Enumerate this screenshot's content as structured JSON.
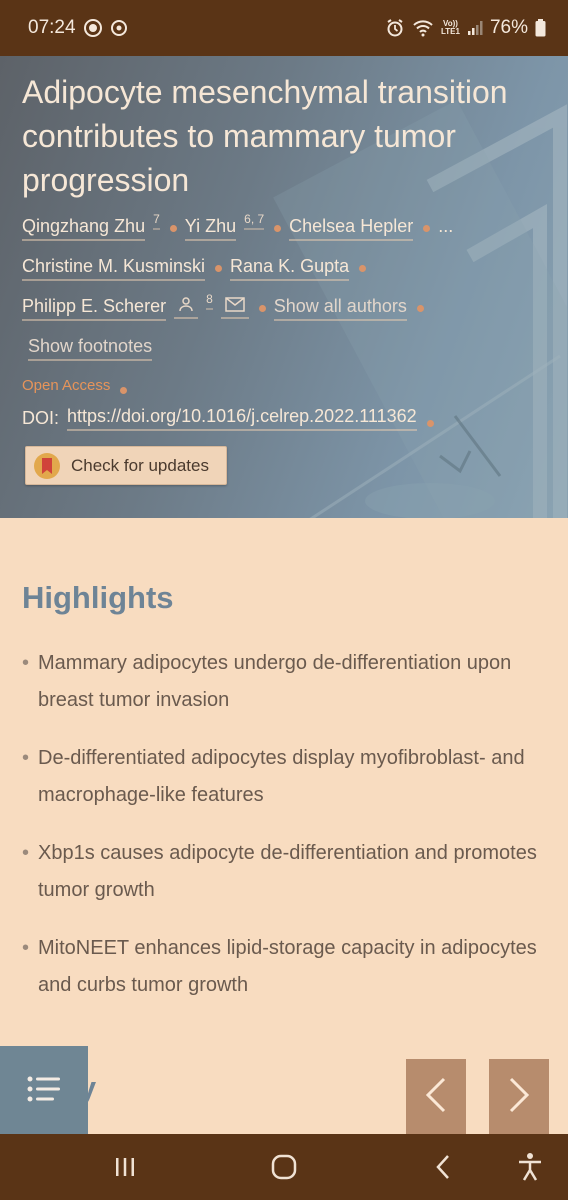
{
  "status_bar": {
    "time": "07:24",
    "network_top": "Vo))",
    "network_bottom": "LTE1",
    "battery": "76%",
    "icons": [
      "media-icon",
      "cast-icon",
      "alarm-icon",
      "wifi-icon",
      "signal-icon",
      "battery-icon"
    ]
  },
  "article": {
    "title": "Adipocyte mesenchymal transition contributes to mammary tumor progression",
    "authors": [
      {
        "name": "Qingzhang Zhu",
        "sup": "7"
      },
      {
        "name": "Yi Zhu",
        "sup": "6, 7"
      },
      {
        "name": "Chelsea Hepler",
        "sup": ""
      },
      {
        "name": "Christine M. Kusminski",
        "sup": ""
      },
      {
        "name": "Rana K. Gupta",
        "sup": ""
      },
      {
        "name": "Philipp E. Scherer",
        "sup": "8"
      }
    ],
    "ellipsis": "...",
    "show_all_authors": "Show all authors",
    "show_footnotes": "Show footnotes",
    "open_access": "Open Access",
    "doi_label": "DOI:",
    "doi_link": "https://doi.org/10.1016/j.celrep.2022.111362",
    "check_updates": "Check for updates"
  },
  "highlights": {
    "heading": "Highlights",
    "items": [
      "Mammary adipocytes undergo de-differentiation upon breast tumor invasion",
      "De-differentiated adipocytes display myofibroblast- and macrophage-like features",
      "Xbp1s causes adipocyte de-differentiation and promotes tumor growth",
      "MitoNEET enhances lipid-storage capacity in adipocytes and curbs tumor growth"
    ]
  },
  "summary_heading_visible": "mary",
  "colors": {
    "status_bar": "#5a3416",
    "page_bg": "#f8dcc0",
    "heading": "#6e8496",
    "body_text": "#6a5a4e",
    "accent_orange": "#e6945a",
    "toc_button": "#6f8694",
    "nav_button": "#b78c6d"
  },
  "bottom_nav": {
    "icons": [
      "recent-apps-icon",
      "home-icon",
      "back-icon",
      "accessibility-icon"
    ]
  }
}
